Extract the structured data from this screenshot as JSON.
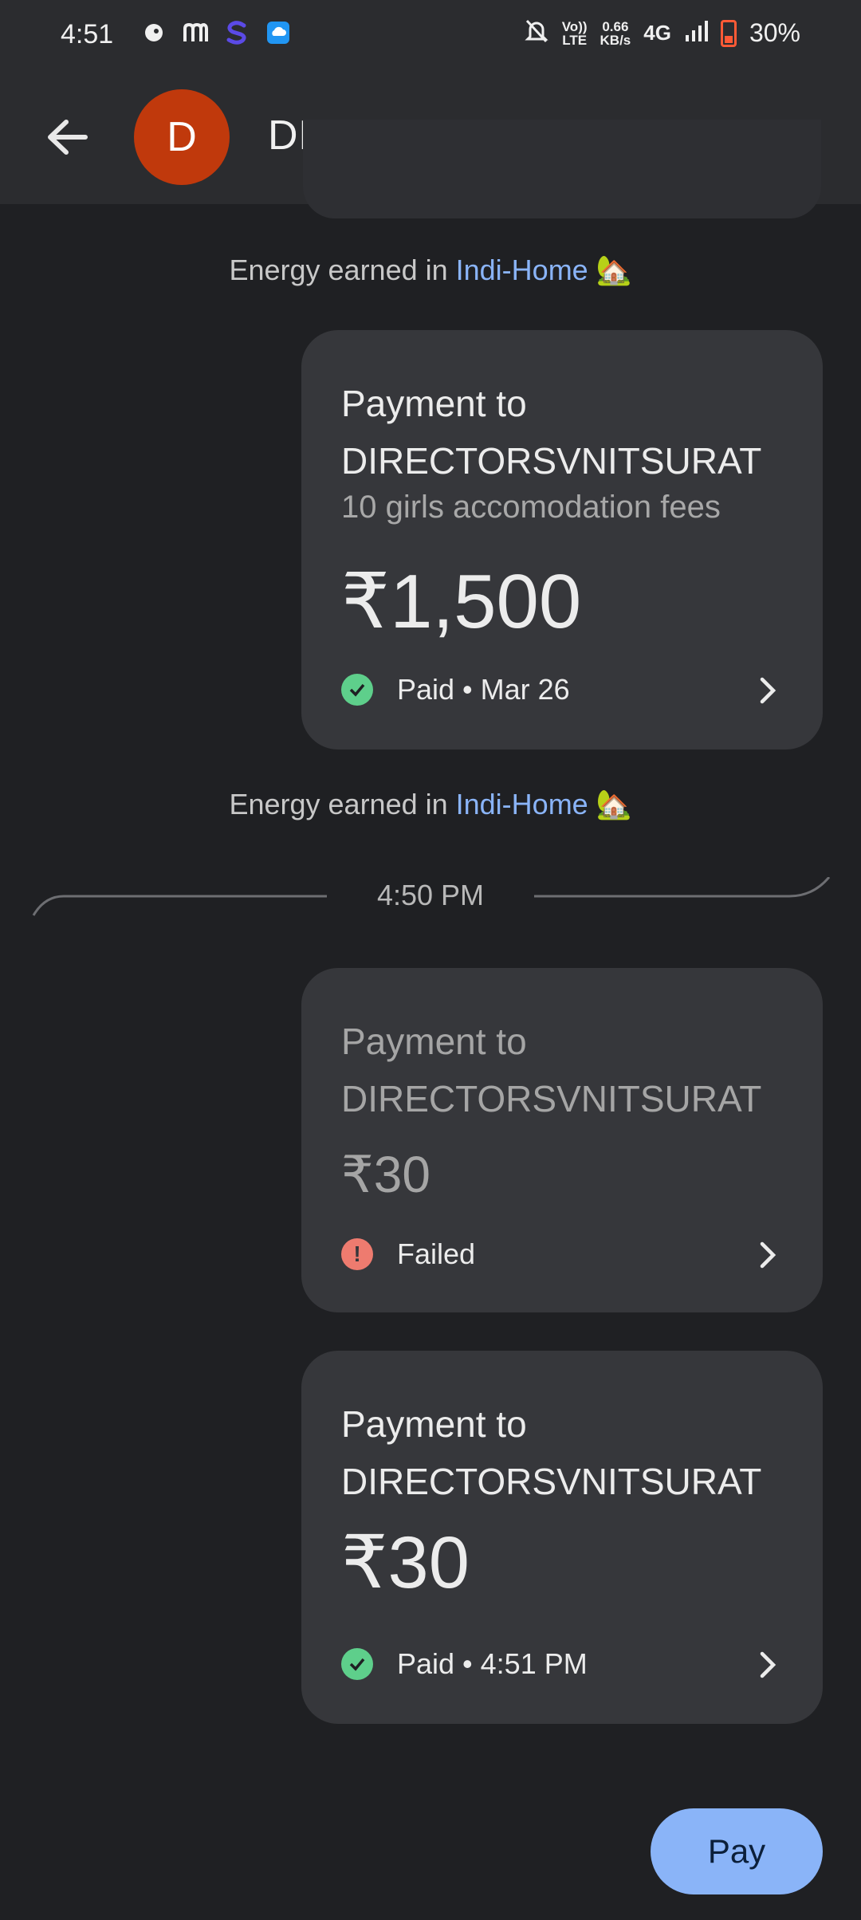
{
  "status_bar": {
    "time": "4:51",
    "volte_top": "Vo))",
    "volte_bottom": "LTE",
    "speed_value": "0.66",
    "speed_unit": "KB/s",
    "network": "4G",
    "battery": "30%"
  },
  "header": {
    "avatar_letter": "D",
    "avatar_color": "#c0390c",
    "name": "DIRECTORSVNITSURAT"
  },
  "energy_1": {
    "prefix": "Energy earned in ",
    "link": "Indi-Home",
    "emoji": "🏡"
  },
  "energy_2": {
    "prefix": "Energy earned in ",
    "link": "Indi-Home",
    "emoji": "🏡"
  },
  "time_divider": "4:50 PM",
  "payments": [
    {
      "title_line1": "Payment to",
      "title_line2": "DIRECTORSVNITSURAT",
      "note": "10 girls accomodation fees",
      "amount": "₹1,500",
      "status": "Paid • Mar 26"
    },
    {
      "title_line1": "Payment to",
      "title_line2": "DIRECTORSVNITSURAT",
      "amount": "₹30",
      "status": "Failed"
    },
    {
      "title_line1": "Payment to",
      "title_line2": "DIRECTORSVNITSURAT",
      "amount": "₹30",
      "status": "Paid • 4:51 PM"
    }
  ],
  "pay_button": "Pay",
  "colors": {
    "accent": "#8ab4f8",
    "success": "#5ecf8b",
    "error": "#ee7b6f"
  }
}
